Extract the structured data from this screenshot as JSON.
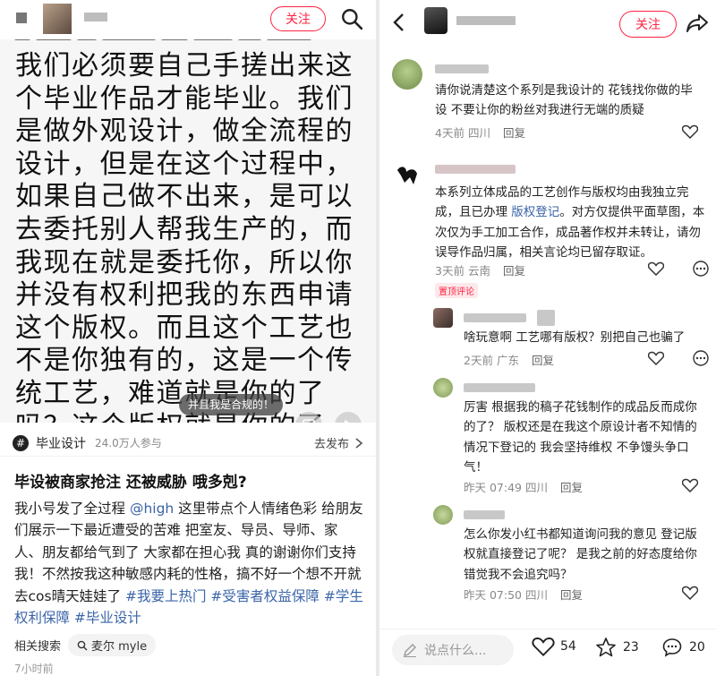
{
  "left": {
    "header": {
      "follow_label": "关注"
    },
    "image_text": "我们必须要自己手搓出来这个毕业作品才能毕业。我们是做外观设计，做全流程的设计，但是在这个过程中，如果自己做不出来，是可以去委托别人帮我生产的，而我现在就是委托你，所以你并没有权利把我的东西申请这个版权。而且这个工艺也不是你独有的，这是一个传统工艺，难道就是你的了吗？这个版权就是你的了吗？",
    "toast": "并且我是合规的！",
    "topic": {
      "name": "毕业设计",
      "count": "24.0万人参与",
      "link": "去发布"
    },
    "post_title": "毕设被商家抢注 还被威胁 哦多剋?",
    "post_body_pre": "我小号发了全过程 ",
    "post_mention": "@high",
    "post_body_mid": " 这里带点个人情绪色彩 给朋友们展示一下最近遭受的苦难 把室友、导员、导师、家人、朋友都给气到了 大家都在担心我 真的谢谢你们支持我！不然按我这种敏感内耗的性格，搞不好一个想不开就去cos晴天娃娃了 ",
    "post_tags": "#我要上热门 #受害者权益保障 #学生权利保障 #毕业设计",
    "related_label": "相关搜索",
    "related_chip": "麦尔 myle",
    "post_time": "7小时前"
  },
  "right": {
    "header": {
      "follow_label": "关注"
    },
    "comments": [
      {
        "text": "请你说清楚这个系列是我设计的 花钱找你做的毕设 不要让你的粉丝对我进行无端的质疑",
        "time": "4天前",
        "location": "四川",
        "reply": "回复"
      },
      {
        "text_pre": "本系列立体成品的工艺创作与版权均由我独立完成，且已办理 ",
        "link": "版权登记",
        "text_post": "。对方仅提供平面草图，本次仅为手工加工合作，成品著作权并未转让，请勿误导作品归属，相关言论均已留存取证。",
        "time": "3天前",
        "location": "云南",
        "reply": "回复",
        "badge": "置顶评论"
      },
      {
        "text": "啥玩意啊 工艺哪有版权？别把自己也骗了",
        "time": "2天前",
        "location": "广东",
        "reply": "回复"
      },
      {
        "text": "厉害 根据我的稿子花钱制作的成品反而成你的了？ 版权还是在我这个原设计者不知情的情况下登记的 我会坚持维权 不争馒头争口气！",
        "time": "昨天 07:49",
        "location": "四川",
        "reply": "回复"
      },
      {
        "text": "怎么你发小红书都知道询问我的意见 登记版权就直接登记了呢？ 是我之前的好态度给你错觉我不会追究吗？",
        "time": "昨天 07:50",
        "location": "四川",
        "reply": "回复"
      }
    ],
    "bottom": {
      "placeholder": "说点什么...",
      "likes": "54",
      "stars": "23",
      "comments": "20"
    }
  }
}
